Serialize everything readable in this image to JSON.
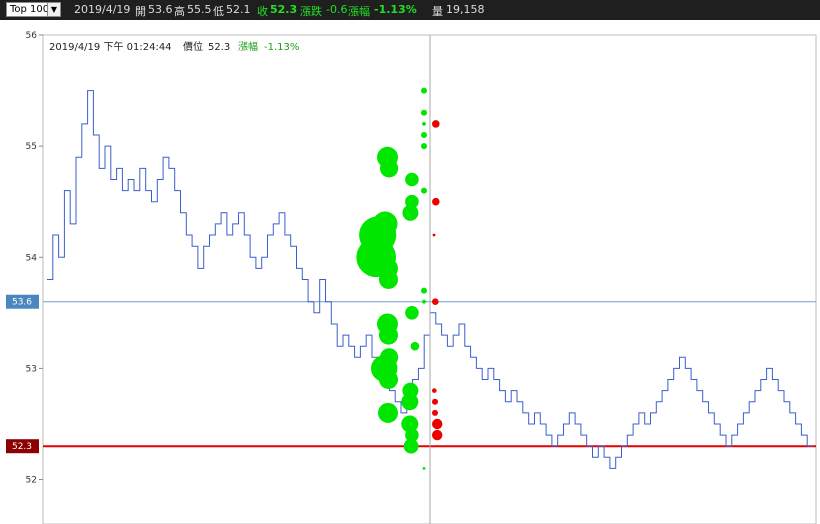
{
  "toolbar": {
    "select_value": "Top 100",
    "date": "2019/4/19",
    "open_label": "開",
    "open_value": "53.6",
    "high_label": "高",
    "high_value": "55.5",
    "low_label": "低",
    "low_value": "52.1",
    "close_label": "收",
    "close_value": "52.3",
    "change_label": "漲跌",
    "change_value": "-0.6",
    "pct_label": "漲幅",
    "pct_value": "-1.13%",
    "vol_label": "量",
    "vol_value": "19,158"
  },
  "info": {
    "datetime": "2019/4/19 下午 01:24:44",
    "price_label": "價位",
    "price_value": "52.3",
    "pct_label": "漲幅",
    "pct_value": "-1.13%"
  },
  "colors": {
    "line": "#3a5fcd",
    "up_bubble": "#00e600",
    "down_bubble": "#ee0000",
    "close_line": "#e60000",
    "open_line": "#6fa0cc",
    "crosshair": "#aaaaaa"
  },
  "chart_data": {
    "type": "line",
    "ylim": [
      51.6,
      56.0
    ],
    "yticks": [
      "52",
      "53",
      "54",
      "55",
      "56"
    ],
    "reference_lines": [
      {
        "value": 53.6,
        "label": "53.6",
        "color": "#4a86c0"
      },
      {
        "value": 52.3,
        "label": "52.3",
        "color": "#8b0000"
      }
    ],
    "price_series": [
      53.8,
      54.2,
      54.0,
      54.6,
      54.3,
      54.9,
      55.2,
      55.5,
      55.1,
      54.8,
      55.0,
      54.7,
      54.8,
      54.6,
      54.7,
      54.6,
      54.8,
      54.6,
      54.5,
      54.7,
      54.9,
      54.8,
      54.6,
      54.4,
      54.2,
      54.1,
      53.9,
      54.1,
      54.2,
      54.3,
      54.4,
      54.2,
      54.3,
      54.4,
      54.2,
      54.0,
      53.9,
      54.0,
      54.2,
      54.3,
      54.4,
      54.2,
      54.1,
      53.9,
      53.8,
      53.6,
      53.5,
      53.8,
      53.6,
      53.4,
      53.2,
      53.3,
      53.2,
      53.1,
      53.2,
      53.3,
      53.1,
      53.0,
      52.9,
      52.8,
      52.7,
      52.6,
      52.7,
      52.9,
      53.0,
      53.3,
      53.5,
      53.4,
      53.3,
      53.2,
      53.3,
      53.4,
      53.2,
      53.1,
      53.0,
      52.9,
      53.0,
      52.9,
      52.8,
      52.7,
      52.8,
      52.7,
      52.6,
      52.5,
      52.6,
      52.5,
      52.4,
      52.3,
      52.4,
      52.5,
      52.6,
      52.5,
      52.4,
      52.3,
      52.2,
      52.3,
      52.2,
      52.1,
      52.2,
      52.3,
      52.4,
      52.5,
      52.6,
      52.5,
      52.6,
      52.7,
      52.8,
      52.9,
      53.0,
      53.1,
      53.0,
      52.9,
      52.8,
      52.7,
      52.6,
      52.5,
      52.4,
      52.3,
      52.4,
      52.5,
      52.6,
      52.7,
      52.8,
      52.9,
      53.0,
      52.9,
      52.8,
      52.7,
      52.6,
      52.5,
      52.4,
      52.3,
      52.3
    ],
    "volume_profile": [
      {
        "price": 55.5,
        "volume": 5,
        "side": "buy"
      },
      {
        "price": 55.3,
        "volume": 5,
        "side": "buy"
      },
      {
        "price": 55.2,
        "volume": 2,
        "side": "buy"
      },
      {
        "price": 55.2,
        "volume": 8,
        "side": "sell"
      },
      {
        "price": 55.1,
        "volume": 5,
        "side": "buy"
      },
      {
        "price": 55.0,
        "volume": 5,
        "side": "buy"
      },
      {
        "price": 54.9,
        "volume": 60,
        "side": "buy"
      },
      {
        "price": 54.8,
        "volume": 45,
        "side": "buy"
      },
      {
        "price": 54.7,
        "volume": 25,
        "side": "buy"
      },
      {
        "price": 54.6,
        "volume": 5,
        "side": "buy"
      },
      {
        "price": 54.5,
        "volume": 25,
        "side": "buy"
      },
      {
        "price": 54.5,
        "volume": 8,
        "side": "sell"
      },
      {
        "price": 54.4,
        "volume": 35,
        "side": "buy"
      },
      {
        "price": 54.3,
        "volume": 85,
        "side": "buy"
      },
      {
        "price": 54.2,
        "volume": 190,
        "side": "buy"
      },
      {
        "price": 54.2,
        "volume": 1,
        "side": "sell"
      },
      {
        "price": 54.0,
        "volume": 215,
        "side": "buy"
      },
      {
        "price": 53.9,
        "volume": 55,
        "side": "buy"
      },
      {
        "price": 53.8,
        "volume": 50,
        "side": "buy"
      },
      {
        "price": 53.7,
        "volume": 5,
        "side": "buy"
      },
      {
        "price": 53.6,
        "volume": 2,
        "side": "buy"
      },
      {
        "price": 53.6,
        "volume": 6,
        "side": "sell"
      },
      {
        "price": 53.5,
        "volume": 25,
        "side": "buy"
      },
      {
        "price": 53.4,
        "volume": 60,
        "side": "buy"
      },
      {
        "price": 53.3,
        "volume": 50,
        "side": "buy"
      },
      {
        "price": 53.2,
        "volume": 10,
        "side": "buy"
      },
      {
        "price": 53.1,
        "volume": 45,
        "side": "buy"
      },
      {
        "price": 53.0,
        "volume": 95,
        "side": "buy"
      },
      {
        "price": 52.9,
        "volume": 50,
        "side": "buy"
      },
      {
        "price": 52.8,
        "volume": 35,
        "side": "buy"
      },
      {
        "price": 52.7,
        "volume": 40,
        "side": "buy"
      },
      {
        "price": 52.8,
        "volume": 3,
        "side": "sell"
      },
      {
        "price": 52.7,
        "volume": 5,
        "side": "sell"
      },
      {
        "price": 52.6,
        "volume": 55,
        "side": "buy"
      },
      {
        "price": 52.6,
        "volume": 5,
        "side": "sell"
      },
      {
        "price": 52.5,
        "volume": 40,
        "side": "buy"
      },
      {
        "price": 52.5,
        "volume": 15,
        "side": "sell"
      },
      {
        "price": 52.4,
        "volume": 25,
        "side": "buy"
      },
      {
        "price": 52.4,
        "volume": 15,
        "side": "sell"
      },
      {
        "price": 52.3,
        "volume": 30,
        "side": "buy"
      },
      {
        "price": 52.1,
        "volume": 1,
        "side": "buy"
      }
    ]
  }
}
